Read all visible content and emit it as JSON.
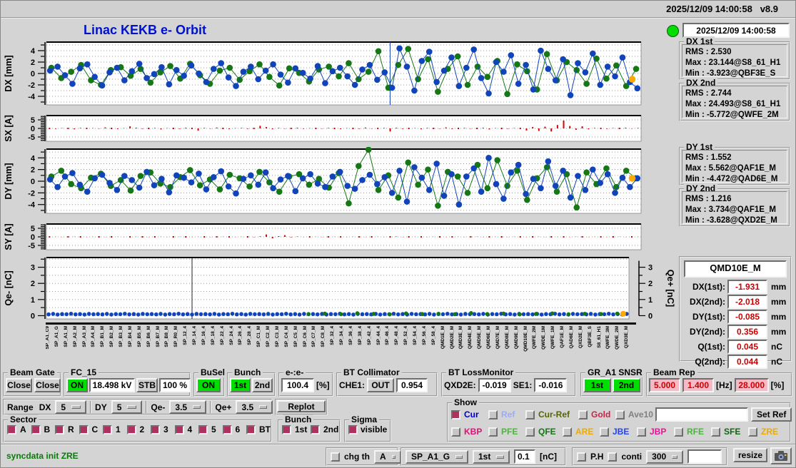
{
  "titlebar": {
    "datetime": "2025/12/09 14:00:58",
    "version": "v8.9"
  },
  "header": {
    "title": "Linac KEKB e- Orbit",
    "status_datetime": "2025/12/09 14:00:58"
  },
  "stats": [
    {
      "title": "DX 1st",
      "rms_label": "RMS :",
      "rms": "2.530",
      "max_label": "Max :",
      "max": "23.144@S8_61_H1",
      "min_label": "Min :",
      "min": "-3.923@QBF3E_S"
    },
    {
      "title": "DX 2nd",
      "rms_label": "RMS :",
      "rms": "2.744",
      "max_label": "Max :",
      "max": "24.493@S8_61_H1",
      "min_label": "Min :",
      "min": "-5.772@QWFE_2M"
    },
    {
      "title": "DY 1st",
      "rms_label": "RMS :",
      "rms": "1.552",
      "max_label": "Max :",
      "max": "5.562@QAF1E_M",
      "min_label": "Min :",
      "min": "-4.472@QAD6E_M"
    },
    {
      "title": "DY 2nd",
      "rms_label": "RMS :",
      "rms": "1.216",
      "max_label": "Max :",
      "max": "3.734@QAF1E_M",
      "min_label": "Min :",
      "min": "-3.628@QXD2E_M"
    }
  ],
  "monitor": {
    "title": "QMD10E_M",
    "rows": [
      {
        "label": "DX(1st):",
        "value": "-1.931",
        "unit": "mm"
      },
      {
        "label": "DX(2nd):",
        "value": "-2.018",
        "unit": "mm"
      },
      {
        "label": "DY(1st):",
        "value": "-0.085",
        "unit": "mm"
      },
      {
        "label": "DY(2nd):",
        "value": "0.356",
        "unit": "mm"
      },
      {
        "label": "Q(1st):",
        "value": "0.045",
        "unit": "nC"
      },
      {
        "label": "Q(2nd):",
        "value": "0.044",
        "unit": "nC"
      }
    ]
  },
  "controls": {
    "beam_gate": {
      "title": "Beam Gate",
      "buttons": [
        "Close",
        "Close"
      ]
    },
    "fc15": {
      "title": "FC_15",
      "on": "ON",
      "kv": "18.498 kV",
      "stb": "STB",
      "pct": "100 %"
    },
    "busel": {
      "title": "BuSel",
      "on": "ON"
    },
    "bunch_sel": {
      "title": "Bunch",
      "first": "1st",
      "second": "2nd"
    },
    "e_ratio": {
      "title": "e-:e-",
      "value": "100.4",
      "unit": "[%]"
    },
    "bt_collimator": {
      "title": "BT Collimator",
      "che1_label": "CHE1:",
      "che1_state": "OUT",
      "che1_value": "0.954"
    },
    "bt_lossmonitor": {
      "title": "BT LossMonitor",
      "qxd2e_label": "QXD2E:",
      "qxd2e": "-0.019",
      "se1_label": "SE1:",
      "se1": "-0.016"
    },
    "gr_a1": {
      "title": "GR_A1 SNSR",
      "first": "1st",
      "second": "2nd"
    },
    "beam_rep": {
      "title": "Beam Rep",
      "v1": "5.000",
      "v2": "1.400",
      "hz": "[Hz]",
      "v3": "28.000",
      "pct": "[%]"
    },
    "range": {
      "label": "Range",
      "dx_label": "DX",
      "dx": "5",
      "dy_label": "DY",
      "dy": "5",
      "qem_label": "Qe-",
      "qem": "3.5",
      "qep_label": "Qe+",
      "qep": "3.5",
      "replot": "Replot"
    },
    "sector": {
      "title": "Sector",
      "items": [
        "A",
        "B",
        "R",
        "C",
        "1",
        "2",
        "3",
        "4",
        "5",
        "6",
        "BT"
      ]
    },
    "bunch_chk": {
      "title": "Bunch",
      "items": [
        "1st",
        "2nd"
      ]
    },
    "sigma": {
      "title": "Sigma",
      "item": "visible"
    },
    "show": {
      "title": "Show",
      "row1": [
        {
          "label": "Cur",
          "color": "#0000cc",
          "checked": true
        },
        {
          "label": "Ref",
          "color": "#99aaff",
          "checked": false
        },
        {
          "label": "Cur-Ref",
          "color": "#556600",
          "checked": false
        },
        {
          "label": "Gold",
          "color": "#cc2244",
          "checked": false
        },
        {
          "label": "Ave10",
          "color": "#808080",
          "checked": false
        }
      ],
      "input": "",
      "set_ref": "Set Ref",
      "row2": [
        {
          "label": "KBP",
          "color": "#dd1177",
          "checked": false
        },
        {
          "label": "PFE",
          "color": "#44bb33",
          "checked": false
        },
        {
          "label": "QFE",
          "color": "#117711",
          "checked": false
        },
        {
          "label": "ARE",
          "color": "#eeaa00",
          "checked": false
        },
        {
          "label": "JBE",
          "color": "#2244ee",
          "checked": false
        },
        {
          "label": "JBP",
          "color": "#ee1199",
          "checked": false
        },
        {
          "label": "RFE",
          "color": "#44bb33",
          "checked": false
        },
        {
          "label": "SFE",
          "color": "#116611",
          "checked": false
        },
        {
          "label": "ZRE",
          "color": "#eeaa00",
          "checked": false
        }
      ]
    }
  },
  "statusbar": {
    "message": "syncdata init ZRE",
    "chg_th": "chg th",
    "chg_th_sel": "A",
    "sp_sel": "SP_A1_G",
    "bunch_sel": "1st",
    "threshold": "0.1",
    "unit": "[nC]",
    "ph": "P.H",
    "conti": "conti",
    "points": "300",
    "free_input": "",
    "resize": "resize"
  },
  "xaxis_labels": [
    "SP_A1_C9",
    "SP_A1_G",
    "SP_A1_M",
    "SP_A2_M",
    "SP_A3_M",
    "SP_A4_M",
    "SP_B1_M",
    "SP_B2_M",
    "SP_B3_M",
    "SP_B4_M",
    "SP_B5_M",
    "SP_B6_M",
    "SP_B7_M",
    "SP_B8_M",
    "SP_R0_M",
    "SP_12_4",
    "SP_14_4",
    "SP_16_4",
    "SP_18_4",
    "SP_22_4",
    "SP_24_4",
    "SP_26_4",
    "SP_28_4",
    "SP_C1_M",
    "SP_C2_M",
    "SP_C3_M",
    "SP_C4_M",
    "SP_C5_M",
    "SP_C6_M",
    "SP_C7_M",
    "SP_C8_M",
    "SP_32_4",
    "SP_34_4",
    "SP_36_4",
    "SP_38_4",
    "SP_42_4",
    "SP_44_4",
    "SP_46_4",
    "SP_48_4",
    "SP_52_4",
    "SP_54_4",
    "SP_56_4",
    "SP_58_4",
    "QMD1E_M",
    "QMD2E_M",
    "QMD3E_M",
    "QMD4E_M",
    "QMD5E_M",
    "QMD6E_M",
    "QMD7E_M",
    "QMD8E_M",
    "QMD9E_M",
    "QMD10E_M",
    "QWFE_2M",
    "QWDE_1M",
    "QWFE_1M",
    "QAF1E_M",
    "QAD6E_M",
    "QXD2E_M",
    "QBF3E_S",
    "S8_61_H1",
    "QWFE_3M",
    "QWDE_2M",
    "QXD3E_M"
  ],
  "chart_data": [
    {
      "id": "dx",
      "type": "line-scatter",
      "ylabel": "DX [mm]",
      "ylim": [
        -5.5,
        5.5
      ],
      "yticks": [
        4,
        2,
        0,
        -2,
        -4
      ],
      "spike_x": 0.578,
      "marker": {
        "x": 0.985,
        "y": -1.0,
        "color": "#ffaa00"
      },
      "series": [
        {
          "name": "bunch2",
          "color": "#157815",
          "values": [
            1.0,
            -0.8,
            0.3,
            1.5,
            -1.2,
            -2.0,
            0.6,
            1.1,
            -0.4,
            0.8,
            -1.6,
            0.2,
            1.3,
            -0.9,
            1.7,
            -0.3,
            -1.8,
            0.5,
            1.0,
            -1.1,
            0.4,
            1.6,
            -0.6,
            -2.1,
            0.9,
            0.1,
            -1.4,
            0.7,
            1.2,
            -0.5,
            1.8,
            -1.0,
            0.3,
            3.9,
            -2.5,
            1.5,
            4.3,
            -1.0,
            2.5,
            -3.2,
            0.8,
            3.0,
            -2.0,
            1.2,
            -0.6,
            2.2,
            -3.6,
            1.6,
            0.4,
            -2.8,
            3.4,
            -1.2,
            2.0,
            0.6,
            -1.8,
            2.6,
            -0.9,
            1.4,
            -2.2,
            0.8
          ]
        },
        {
          "name": "bunch1",
          "color": "#1144bb",
          "values": [
            0.5,
            1.2,
            -0.3,
            -1.8,
            0.9,
            1.6,
            -0.6,
            -2.1,
            0.2,
            1.0,
            -1.2,
            0.4,
            1.7,
            -0.8,
            -0.1,
            1.1,
            -1.9,
            0.6,
            -0.4,
            1.4,
            0.0,
            -1.5,
            0.8,
            1.8,
            -0.7,
            -2.2,
            0.3,
            1.2,
            -1.0,
            0.5,
            1.6,
            -0.2,
            -1.6,
            0.9,
            0.1,
            -0.9,
            1.3,
            -1.7,
            0.4,
            1.0,
            -0.5,
            -2.0,
            0.7,
            1.5,
            -1.1,
            0.2,
            -2.5,
            4.4,
            1.2,
            -3.0,
            2.2,
            3.8,
            -1.5,
            0.5,
            2.8,
            -2.2,
            1.0,
            4.2,
            -0.8,
            -3.5,
            2.0,
            0.3,
            3.2,
            -1.8,
            1.5,
            -2.8,
            4.0,
            0.8,
            -1.2,
            2.5,
            -3.8,
            1.8,
            0.2,
            3.5,
            -2.0,
            1.2,
            -0.5,
            2.8,
            -1.5,
            -2.6
          ]
        }
      ]
    },
    {
      "id": "sx",
      "type": "bar",
      "ylabel": "SX [A]",
      "ylim": [
        -7.5,
        7.5
      ],
      "yticks": [
        5,
        0,
        -5
      ],
      "color": "#dd0000",
      "values": [
        0,
        -0.3,
        0.2,
        0,
        -0.5,
        0.3,
        0,
        0.2,
        -0.2,
        0.6,
        0,
        -0.4,
        0.2,
        1.2,
        0.4,
        -0.3,
        0,
        0.3,
        -0.6,
        0.2,
        0,
        -0.3,
        0.4,
        0,
        -1.3,
        0.3,
        -0.2,
        0.5,
        0,
        -0.4,
        0.2,
        0.3,
        -0.3,
        0,
        1.5,
        0.8,
        -0.5,
        0.3,
        -0.2,
        0,
        0.4,
        -0.3,
        0.2,
        0,
        -0.2,
        0.3,
        0,
        -0.4,
        0.2,
        0,
        -0.3,
        0.5,
        -0.2,
        0,
        0.3,
        -1.8,
        0.4,
        -0.3,
        0,
        0.2,
        -0.5,
        0.3,
        0,
        -0.2,
        0.6,
        -0.4,
        0,
        0.3,
        -0.2,
        0,
        0.4,
        -0.6,
        0.2,
        0,
        -0.3,
        0.2,
        0,
        -1.2,
        0.8,
        -1.5,
        1.0,
        -1.8,
        2.0,
        4.6,
        1.4,
        -0.8,
        1.2,
        -0.5,
        0.3,
        0,
        -0.3,
        0.2,
        0,
        0.4,
        -0.2,
        0.3
      ]
    },
    {
      "id": "dy",
      "type": "line-scatter",
      "ylabel": "DY [mm]",
      "ylim": [
        -5.5,
        5.5
      ],
      "yticks": [
        4,
        2,
        0,
        -2,
        -4
      ],
      "marker": {
        "x": 0.985,
        "y": 0.5,
        "color": "#ffaa00"
      },
      "series": [
        {
          "name": "bunch2",
          "color": "#157815",
          "values": [
            0.8,
            1.8,
            -0.5,
            -1.2,
            0.6,
            1.3,
            -0.8,
            0.2,
            -1.6,
            0.9,
            1.5,
            -0.4,
            -1.0,
            0.7,
            1.9,
            -0.7,
            0.3,
            -1.4,
            1.1,
            0.5,
            -0.9,
            1.6,
            -0.2,
            -1.8,
            0.8,
            1.2,
            -0.6,
            0.4,
            -1.1,
            1.4,
            -3.8,
            2.6,
            5.4,
            -1.5,
            1.0,
            -2.8,
            3.2,
            -0.6,
            2.0,
            -4.2,
            1.6,
            0.8,
            -2.0,
            2.8,
            -1.2,
            3.6,
            -0.8,
            1.8,
            -3.2,
            0.5,
            2.4,
            -1.8,
            1.2,
            -4.5,
            1.5,
            -0.5,
            2.2,
            -1.0,
            1.8,
            0.5
          ]
        },
        {
          "name": "bunch1",
          "color": "#1144bb",
          "values": [
            0.3,
            -1.0,
            0.8,
            1.4,
            -0.6,
            -1.8,
            0.5,
            1.1,
            -0.3,
            -1.5,
            0.9,
            0.2,
            -1.1,
            1.6,
            -0.7,
            0.4,
            -1.9,
            1.0,
            0.6,
            -0.2,
            1.3,
            -1.4,
            0.7,
            1.7,
            -0.9,
            -2.1,
            0.4,
            1.0,
            -0.6,
            1.5,
            -1.2,
            0.3,
            0.9,
            -1.7,
            0.5,
            1.2,
            -0.4,
            -1.0,
            0.8,
            1.6,
            -0.8,
            -1.3,
            0.2,
            1.1,
            -0.5,
            0.7,
            -2.0,
            1.8,
            -3.5,
            2.4,
            0.6,
            -1.5,
            3.0,
            -2.5,
            1.2,
            -4.0,
            0.8,
            2.2,
            -1.8,
            4.0,
            -0.5,
            -3.0,
            1.5,
            2.8,
            -2.2,
            0.4,
            -1.2,
            3.4,
            -0.8,
            1.8,
            -2.8,
            0.9,
            -1.5,
            2.0,
            -0.3,
            1.2,
            -2.0,
            0.6,
            -1.0,
            0.5
          ]
        }
      ]
    },
    {
      "id": "sy",
      "type": "bar",
      "ylabel": "SY [A]",
      "ylim": [
        -7.5,
        7.5
      ],
      "yticks": [
        5,
        0,
        -5
      ],
      "color": "#dd0000",
      "values": [
        0,
        0.1,
        -0.1,
        0,
        0.1,
        0,
        -0.1,
        0.1,
        0,
        -0.1,
        0,
        0.1,
        -0.1,
        0,
        0.1,
        0,
        -0.1,
        0,
        0.1,
        -0.1,
        0,
        0.1,
        0,
        -0.1,
        0.1,
        0,
        -0.1,
        0,
        0.1,
        0,
        -0.1,
        0.1,
        0,
        -0.2,
        0.3,
        1.4,
        -0.9,
        0.4,
        1.0,
        -0.3,
        0.2,
        -0.1,
        0,
        0.1,
        -0.1,
        0,
        0.1,
        0,
        -0.1,
        0.1,
        0,
        -0.1,
        0,
        0.1,
        -0.1,
        0,
        0.2,
        -0.1,
        0,
        0.1,
        0,
        -0.1,
        0.1,
        0,
        -0.1,
        0,
        0.1,
        -0.1,
        0,
        0.1,
        -0.1,
        0,
        0.1,
        0,
        -0.1,
        0.1,
        0,
        -0.1,
        0,
        0.1,
        -0.1,
        0,
        0.1,
        0,
        -0.1,
        0.1,
        0,
        -0.1,
        0.1,
        0,
        -0.1,
        0,
        0.1,
        -0.1,
        0,
        0.1
      ]
    },
    {
      "id": "qe",
      "type": "scatter",
      "ylabel": "Qe- [nC]",
      "ylabel_right": "Qe+ [nC]",
      "ylim": [
        -0.2,
        3.6
      ],
      "yticks": [
        3,
        2,
        1,
        0
      ],
      "spike_x": 0.25,
      "blue_color": "#1144bb",
      "blue_count": 130,
      "blue_pattern": [
        0.08,
        0.11,
        0.07,
        0.1,
        0.09,
        0.12,
        0.08,
        0.1,
        0.07,
        0.11,
        0.09,
        0.1
      ],
      "green_color": "#157815",
      "green_xstart": 0.45,
      "green_values": [
        0.1,
        0.13,
        0.09,
        0.15,
        0.11,
        0.08,
        0.14,
        0.1,
        0.12,
        0.09,
        0.16,
        0.1,
        0.13,
        0.08,
        0.11,
        0.14,
        0.09,
        0.12,
        0.1,
        0.13
      ],
      "orange": {
        "x": 0.99,
        "y": 0.12,
        "color": "#ffaa00"
      }
    }
  ]
}
